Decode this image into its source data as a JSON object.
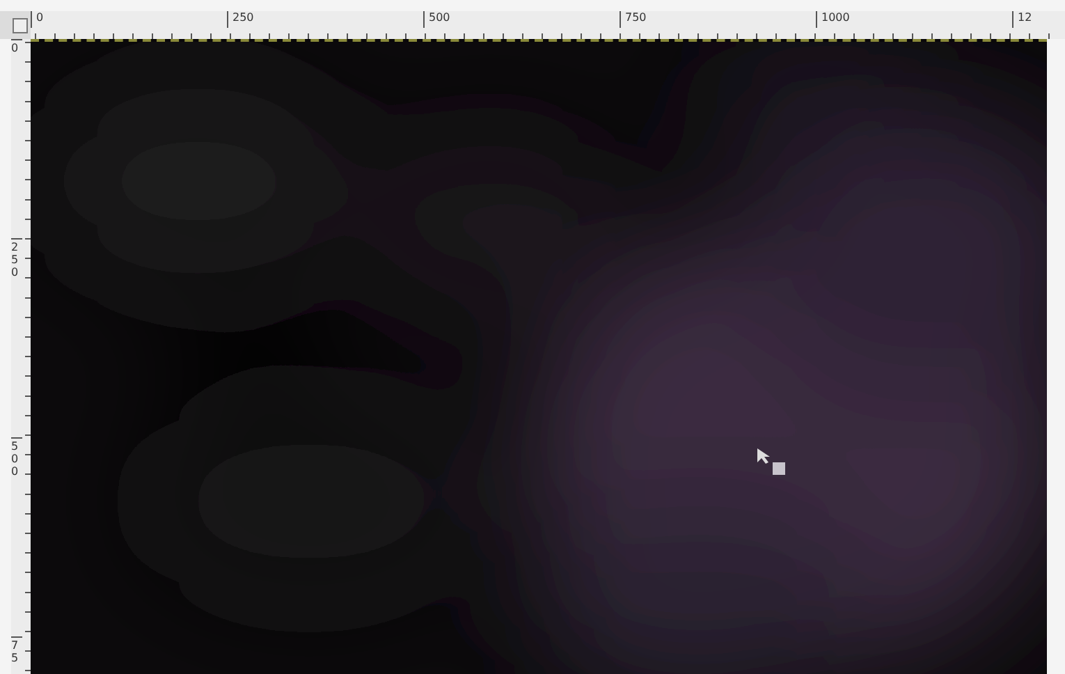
{
  "rulers": {
    "horizontal": [
      "0",
      "250",
      "500",
      "750",
      "1000",
      "12"
    ],
    "vertical": [
      "0",
      "250",
      "500",
      "75"
    ]
  }
}
